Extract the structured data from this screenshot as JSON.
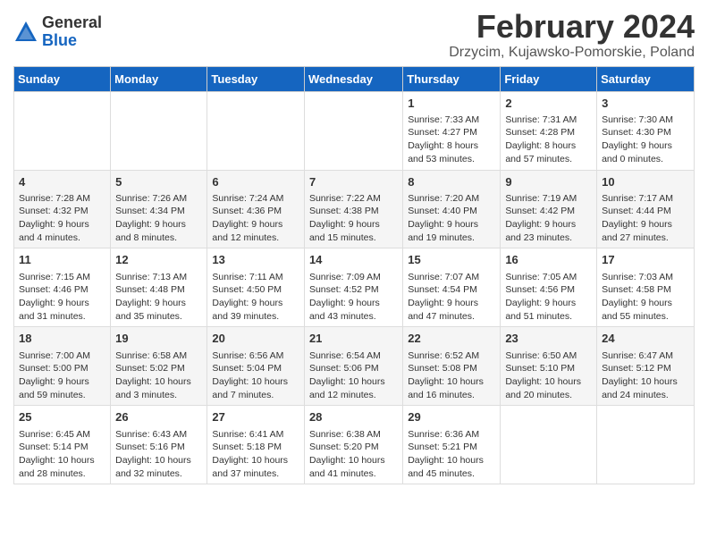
{
  "logo": {
    "general": "General",
    "blue": "Blue"
  },
  "title": "February 2024",
  "location": "Drzycim, Kujawsko-Pomorskie, Poland",
  "headers": [
    "Sunday",
    "Monday",
    "Tuesday",
    "Wednesday",
    "Thursday",
    "Friday",
    "Saturday"
  ],
  "weeks": [
    [
      {
        "day": "",
        "info": ""
      },
      {
        "day": "",
        "info": ""
      },
      {
        "day": "",
        "info": ""
      },
      {
        "day": "",
        "info": ""
      },
      {
        "day": "1",
        "info": "Sunrise: 7:33 AM\nSunset: 4:27 PM\nDaylight: 8 hours\nand 53 minutes."
      },
      {
        "day": "2",
        "info": "Sunrise: 7:31 AM\nSunset: 4:28 PM\nDaylight: 8 hours\nand 57 minutes."
      },
      {
        "day": "3",
        "info": "Sunrise: 7:30 AM\nSunset: 4:30 PM\nDaylight: 9 hours\nand 0 minutes."
      }
    ],
    [
      {
        "day": "4",
        "info": "Sunrise: 7:28 AM\nSunset: 4:32 PM\nDaylight: 9 hours\nand 4 minutes."
      },
      {
        "day": "5",
        "info": "Sunrise: 7:26 AM\nSunset: 4:34 PM\nDaylight: 9 hours\nand 8 minutes."
      },
      {
        "day": "6",
        "info": "Sunrise: 7:24 AM\nSunset: 4:36 PM\nDaylight: 9 hours\nand 12 minutes."
      },
      {
        "day": "7",
        "info": "Sunrise: 7:22 AM\nSunset: 4:38 PM\nDaylight: 9 hours\nand 15 minutes."
      },
      {
        "day": "8",
        "info": "Sunrise: 7:20 AM\nSunset: 4:40 PM\nDaylight: 9 hours\nand 19 minutes."
      },
      {
        "day": "9",
        "info": "Sunrise: 7:19 AM\nSunset: 4:42 PM\nDaylight: 9 hours\nand 23 minutes."
      },
      {
        "day": "10",
        "info": "Sunrise: 7:17 AM\nSunset: 4:44 PM\nDaylight: 9 hours\nand 27 minutes."
      }
    ],
    [
      {
        "day": "11",
        "info": "Sunrise: 7:15 AM\nSunset: 4:46 PM\nDaylight: 9 hours\nand 31 minutes."
      },
      {
        "day": "12",
        "info": "Sunrise: 7:13 AM\nSunset: 4:48 PM\nDaylight: 9 hours\nand 35 minutes."
      },
      {
        "day": "13",
        "info": "Sunrise: 7:11 AM\nSunset: 4:50 PM\nDaylight: 9 hours\nand 39 minutes."
      },
      {
        "day": "14",
        "info": "Sunrise: 7:09 AM\nSunset: 4:52 PM\nDaylight: 9 hours\nand 43 minutes."
      },
      {
        "day": "15",
        "info": "Sunrise: 7:07 AM\nSunset: 4:54 PM\nDaylight: 9 hours\nand 47 minutes."
      },
      {
        "day": "16",
        "info": "Sunrise: 7:05 AM\nSunset: 4:56 PM\nDaylight: 9 hours\nand 51 minutes."
      },
      {
        "day": "17",
        "info": "Sunrise: 7:03 AM\nSunset: 4:58 PM\nDaylight: 9 hours\nand 55 minutes."
      }
    ],
    [
      {
        "day": "18",
        "info": "Sunrise: 7:00 AM\nSunset: 5:00 PM\nDaylight: 9 hours\nand 59 minutes."
      },
      {
        "day": "19",
        "info": "Sunrise: 6:58 AM\nSunset: 5:02 PM\nDaylight: 10 hours\nand 3 minutes."
      },
      {
        "day": "20",
        "info": "Sunrise: 6:56 AM\nSunset: 5:04 PM\nDaylight: 10 hours\nand 7 minutes."
      },
      {
        "day": "21",
        "info": "Sunrise: 6:54 AM\nSunset: 5:06 PM\nDaylight: 10 hours\nand 12 minutes."
      },
      {
        "day": "22",
        "info": "Sunrise: 6:52 AM\nSunset: 5:08 PM\nDaylight: 10 hours\nand 16 minutes."
      },
      {
        "day": "23",
        "info": "Sunrise: 6:50 AM\nSunset: 5:10 PM\nDaylight: 10 hours\nand 20 minutes."
      },
      {
        "day": "24",
        "info": "Sunrise: 6:47 AM\nSunset: 5:12 PM\nDaylight: 10 hours\nand 24 minutes."
      }
    ],
    [
      {
        "day": "25",
        "info": "Sunrise: 6:45 AM\nSunset: 5:14 PM\nDaylight: 10 hours\nand 28 minutes."
      },
      {
        "day": "26",
        "info": "Sunrise: 6:43 AM\nSunset: 5:16 PM\nDaylight: 10 hours\nand 32 minutes."
      },
      {
        "day": "27",
        "info": "Sunrise: 6:41 AM\nSunset: 5:18 PM\nDaylight: 10 hours\nand 37 minutes."
      },
      {
        "day": "28",
        "info": "Sunrise: 6:38 AM\nSunset: 5:20 PM\nDaylight: 10 hours\nand 41 minutes."
      },
      {
        "day": "29",
        "info": "Sunrise: 6:36 AM\nSunset: 5:21 PM\nDaylight: 10 hours\nand 45 minutes."
      },
      {
        "day": "",
        "info": ""
      },
      {
        "day": "",
        "info": ""
      }
    ]
  ]
}
